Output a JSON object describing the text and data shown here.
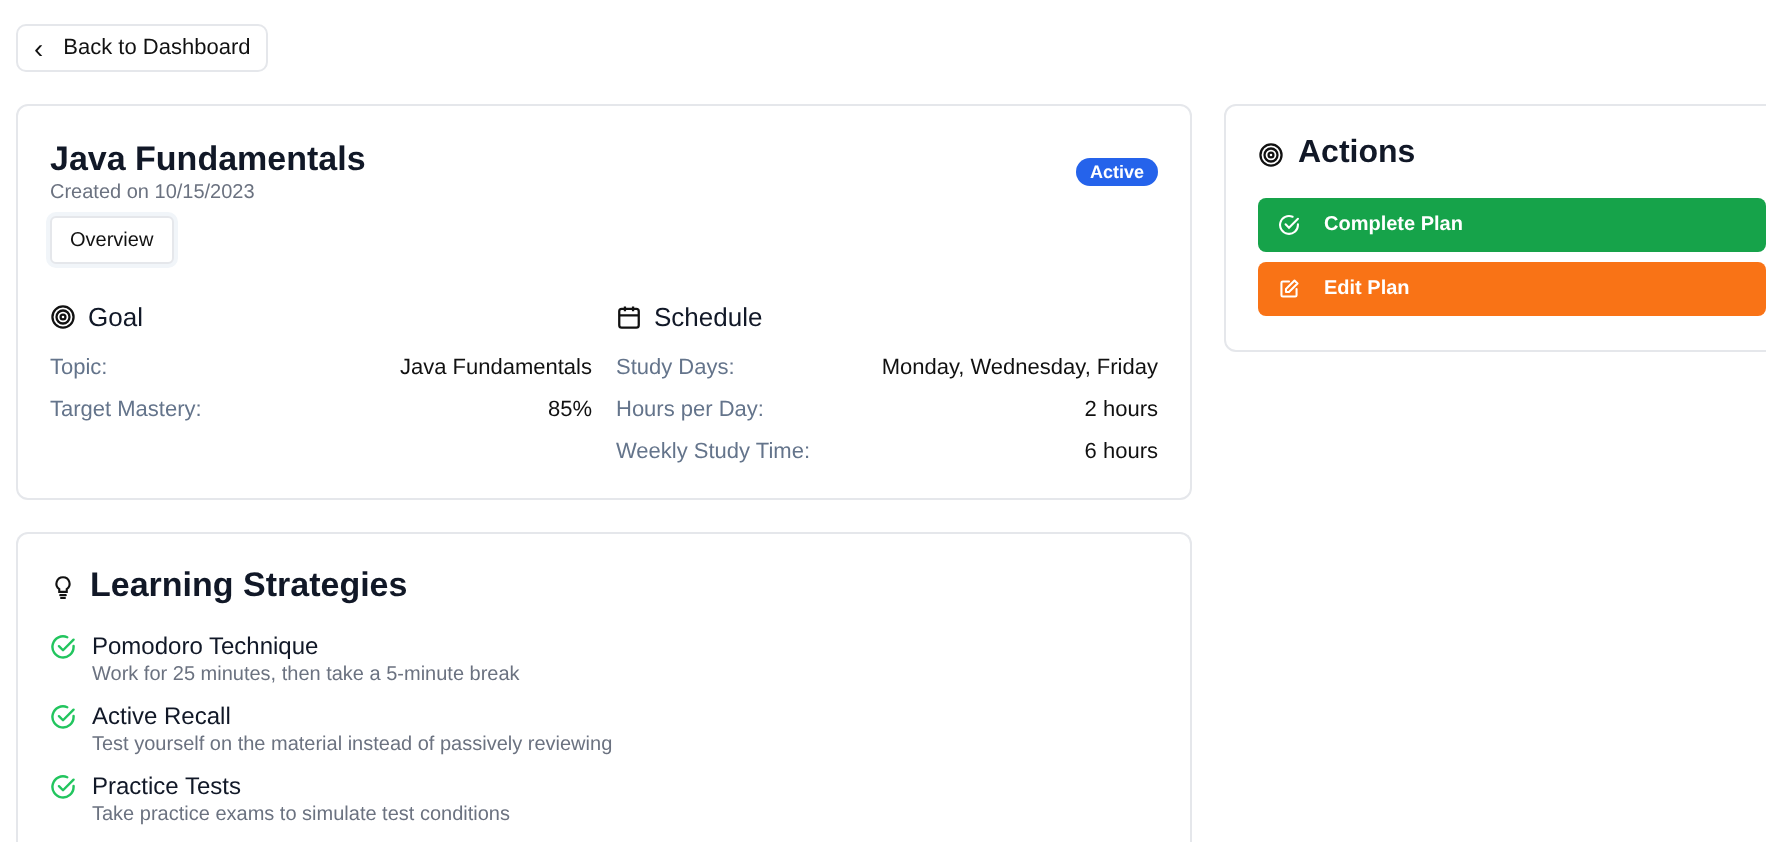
{
  "back_button": {
    "icon": "‹",
    "label": "Back to Dashboard"
  },
  "plan": {
    "title": "Java Fundamentals",
    "created": "Created on 10/15/2023",
    "status": {
      "label": "Active",
      "kind": "active"
    },
    "tabs": [
      {
        "label": "Overview",
        "selected": true
      }
    ],
    "goal": {
      "title": "Goal",
      "rows": [
        {
          "label": "Topic:",
          "value": "Java Fundamentals"
        },
        {
          "label": "Target Mastery:",
          "value": "85%"
        }
      ]
    },
    "schedule": {
      "title": "Schedule",
      "rows": [
        {
          "label": "Study Days:",
          "value": "Monday, Wednesday, Friday"
        },
        {
          "label": "Hours per Day:",
          "value": "2 hours"
        },
        {
          "label": "Weekly Study Time:",
          "value": "6 hours"
        }
      ]
    }
  },
  "strategies": {
    "title": "Learning Strategies",
    "items": [
      {
        "name": "Pomodoro Technique",
        "description": "Work for 25 minutes, then take a 5-minute break",
        "checked": true
      },
      {
        "name": "Active Recall",
        "description": "Test yourself on the material instead of passively reviewing",
        "checked": true
      },
      {
        "name": "Practice Tests",
        "description": "Take practice exams to simulate test conditions",
        "checked": true
      }
    ]
  },
  "actions": {
    "title": "Actions",
    "buttons": [
      {
        "label": "Complete Plan",
        "kind": "complete"
      },
      {
        "label": "Edit Plan",
        "kind": "edit"
      }
    ]
  }
}
